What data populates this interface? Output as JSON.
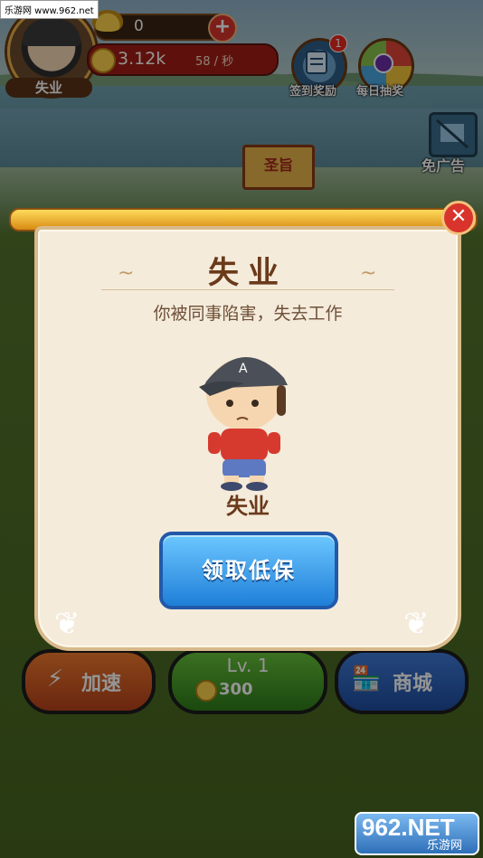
{
  "watermark_top": "乐游网 www.962.net",
  "player": {
    "name": "失业"
  },
  "currency": {
    "gold": "0",
    "coins": "3.12k",
    "rate": "58 / 秒"
  },
  "hud_buttons": {
    "signin_label": "签到奖励",
    "signin_badge": "1",
    "lottery_label": "每日抽奖",
    "ad_label": "免广告"
  },
  "edict": {
    "text": "圣旨"
  },
  "dialog": {
    "title": "失业",
    "description": "你被同事陷害，失去工作",
    "job_name": "失业",
    "claim_button": "领取低保",
    "close_symbol": "✕"
  },
  "bottom_bar": {
    "speed_label": "加速",
    "level_label": "Lv. 1",
    "level_cost": "300",
    "shop_label": "商城"
  },
  "watermark_bottom": {
    "brand": "962.NET",
    "sub": "乐游网"
  },
  "colors": {
    "panel_bg": "#f4ebdb",
    "claim_button": "#1f7fd8",
    "speed": "#f07a2e",
    "level": "#66c13a",
    "shop": "#3f7bd6"
  }
}
